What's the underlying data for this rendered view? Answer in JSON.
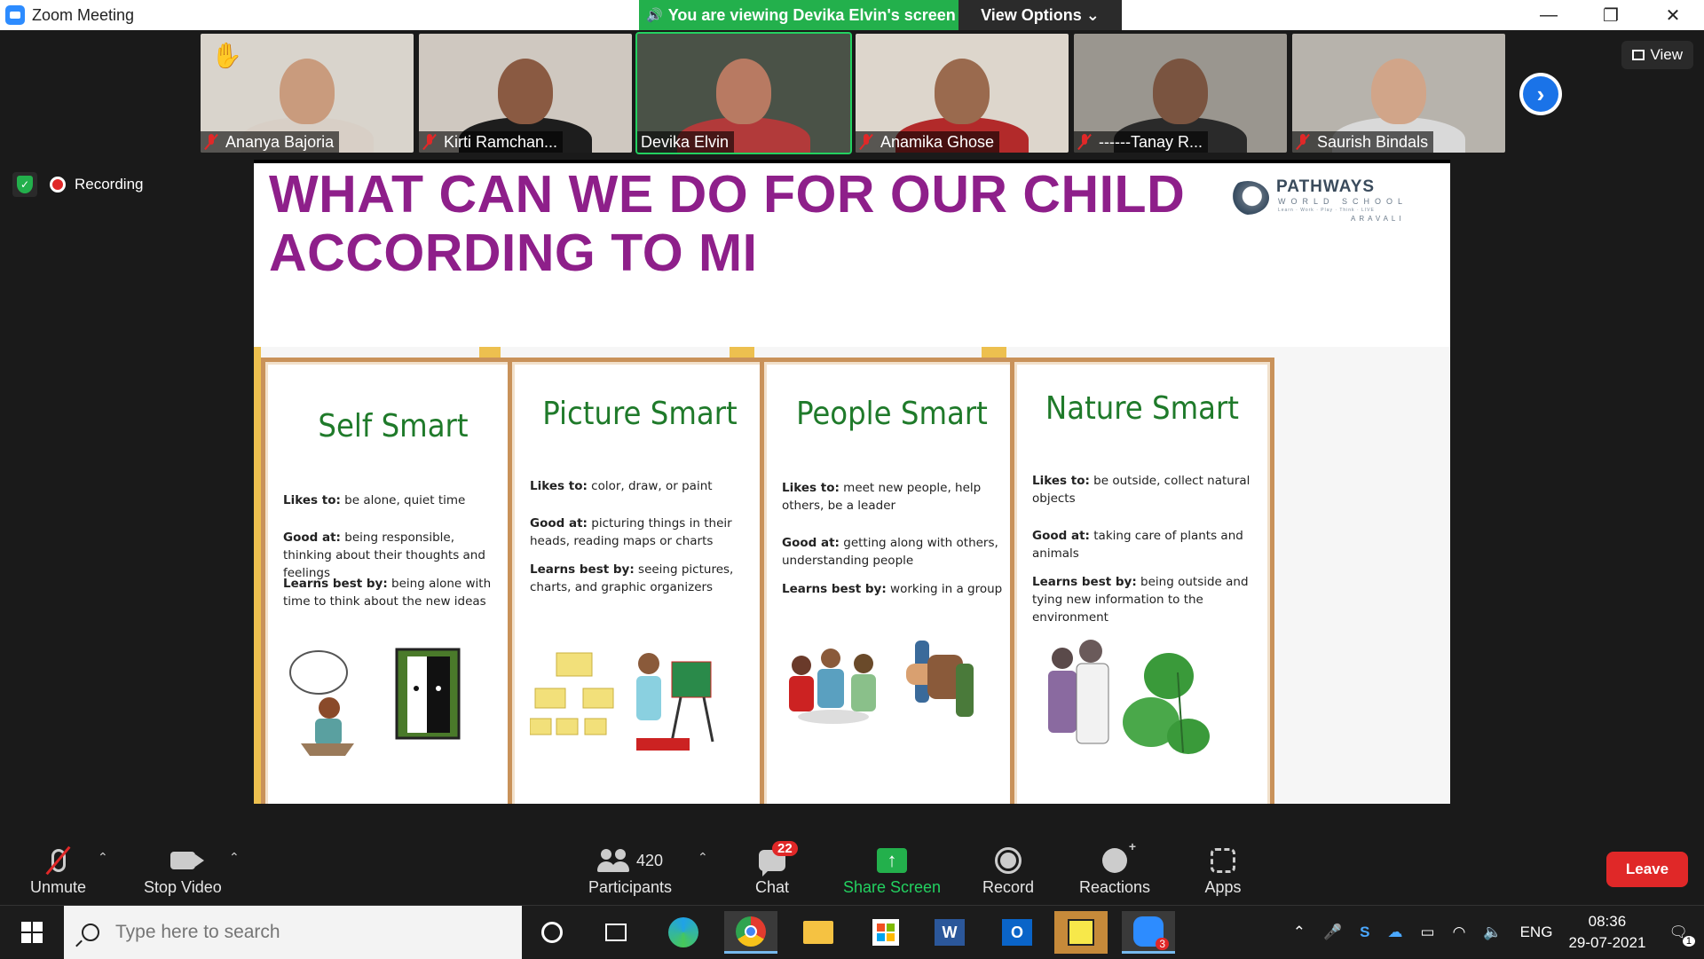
{
  "window": {
    "title": "Zoom Meeting",
    "minimize": "—",
    "restore": "❐",
    "close": "✕"
  },
  "banner": {
    "viewing_text": "You are viewing Devika Elvin's screen",
    "view_options": "View Options ⌄"
  },
  "view_button": {
    "label": "View"
  },
  "participants": [
    {
      "name": "Ananya Bajoria",
      "muted": true,
      "hand_raised": true,
      "bg": "#d9d4cc",
      "skin": "#c99b7d",
      "shirt": "#d8cfc6"
    },
    {
      "name": "Kirti Ramchan...",
      "muted": true,
      "hand_raised": false,
      "bg": "#cfc8c0",
      "skin": "#8a5a42",
      "shirt": "#1d1d1d"
    },
    {
      "name": "Devika Elvin",
      "muted": false,
      "hand_raised": false,
      "bg": "#4a5247",
      "skin": "#b87a62",
      "shirt": "#b23a3a"
    },
    {
      "name": "Anamika Ghose",
      "muted": true,
      "hand_raised": false,
      "bg": "#ddd6cc",
      "skin": "#9a6a4e",
      "shirt": "#b22a2a"
    },
    {
      "name": "------Tanay R...",
      "muted": true,
      "hand_raised": false,
      "bg": "#9a968f",
      "skin": "#7a5440",
      "shirt": "#2a2a2a"
    },
    {
      "name": "Saurish Bindals",
      "muted": true,
      "hand_raised": false,
      "bg": "#b7b3ac",
      "skin": "#d1a589",
      "shirt": "#d9d9d9"
    }
  ],
  "recording": {
    "label": "Recording"
  },
  "slide": {
    "title_line1": "WHAT CAN WE DO FOR OUR CHILD",
    "title_line2": "ACCORDING TO MI",
    "logo": {
      "brand": "PATHWAYS",
      "sub": "WORLD SCHOOL",
      "tagline": "Learn · Work · Play · Think · LIVE",
      "campus": "ARAVALI"
    },
    "cards": [
      {
        "title": "Self Smart",
        "likes_label": "Likes to:",
        "likes": " be alone, quiet time",
        "good_label": "Good at:",
        "good": " being responsible, thinking about their thoughts and feelings",
        "learns_label": "Learns best by:",
        "learns": " being alone with time to think about the new ideas"
      },
      {
        "title": "Picture Smart",
        "likes_label": "Likes to:",
        "likes": " color, draw, or paint",
        "good_label": "Good at:",
        "good": " picturing things in their heads, reading maps or charts",
        "learns_label": "Learns best by:",
        "learns": " seeing pictures, charts, and graphic organizers"
      },
      {
        "title": "People Smart",
        "likes_label": "Likes to:",
        "likes": " meet new people, help others, be a leader",
        "good_label": "Good at:",
        "good": " getting along with others, understanding people",
        "learns_label": "Learns best by:",
        "learns": " working in a group"
      },
      {
        "title": "Nature Smart",
        "likes_label": "Likes to:",
        "likes": " be outside, collect natural objects",
        "good_label": "Good at:",
        "good": " taking care of plants and animals",
        "learns_label": "Learns best by:",
        "learns": " being outside and tying new information to the environment"
      }
    ]
  },
  "toolbar": {
    "unmute": "Unmute",
    "stop_video": "Stop Video",
    "participants_label": "Participants",
    "participants_count": "420",
    "chat_label": "Chat",
    "chat_badge": "22",
    "share_label": "Share Screen",
    "record_label": "Record",
    "reactions_label": "Reactions",
    "apps_label": "Apps",
    "leave_label": "Leave"
  },
  "taskbar": {
    "search_placeholder": "Type here to search",
    "zoom_badge": "3",
    "language": "ENG",
    "time": "08:36",
    "date": "29-07-2021",
    "notifications": "1"
  },
  "colors": {
    "accent_green": "#23b04c",
    "leave_red": "#e02828",
    "slide_title": "#8e1f8a",
    "card_title": "#1f7a2a",
    "stripe": "#edc04f"
  }
}
